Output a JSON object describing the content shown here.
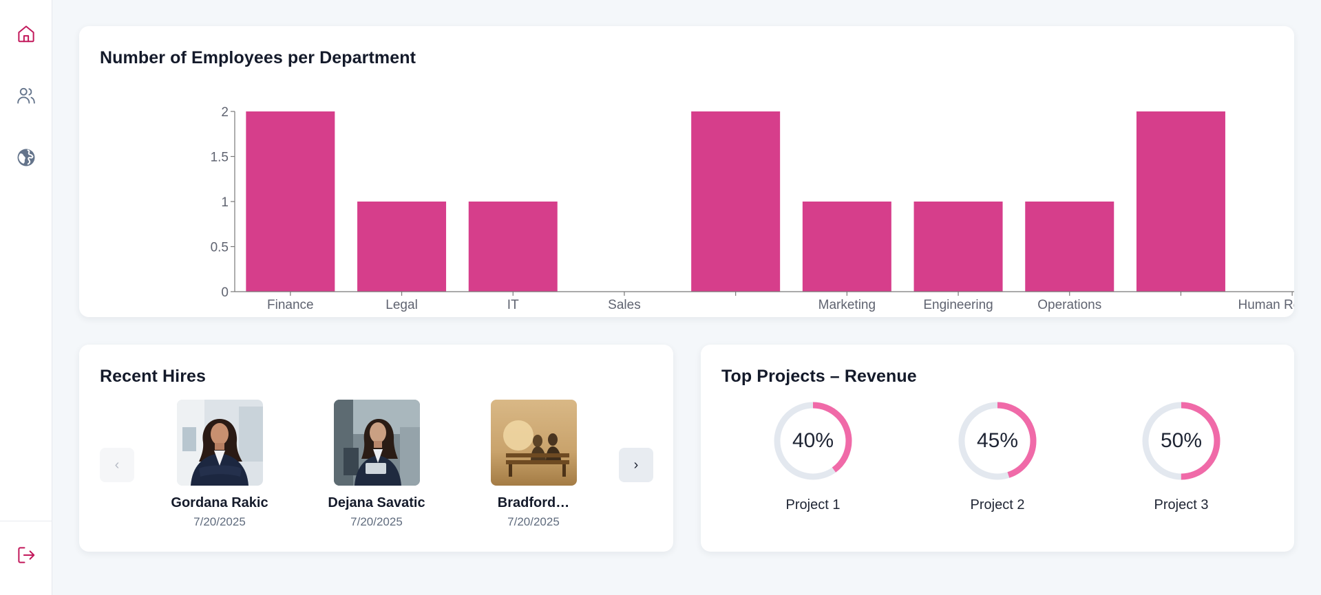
{
  "theme": {
    "accent": "#d63e8b",
    "ring_fill": "#f06aa8",
    "ring_track": "#e3e8ef",
    "nav_active": "#c2185b",
    "nav_muted": "#64748b"
  },
  "nav": {
    "items": [
      {
        "icon": "home-icon",
        "active": true
      },
      {
        "icon": "users-icon",
        "active": false
      },
      {
        "icon": "globe-icon",
        "active": false
      }
    ],
    "logout_icon": "logout-icon"
  },
  "employees_chart": {
    "title": "Number of Employees per Department",
    "chart_data": {
      "type": "bar",
      "categories": [
        "Finance",
        "Legal",
        "IT",
        "Sales",
        "",
        "Marketing",
        "Engineering",
        "Operations",
        "",
        "Human Resources"
      ],
      "values": [
        2,
        1,
        1,
        0,
        2,
        1,
        1,
        1,
        2,
        0
      ],
      "ylim": [
        0,
        2
      ],
      "yticks": [
        "0",
        "0.5",
        "1",
        "1.5",
        "2"
      ],
      "grid": false,
      "bar_color": "#d63e8b"
    }
  },
  "recent_hires": {
    "title": "Recent Hires",
    "prev_label": "‹",
    "next_label": "›",
    "items": [
      {
        "name": "Gordana Rakic",
        "date": "7/20/2025"
      },
      {
        "name": "Dejana Savatic",
        "date": "7/20/2025"
      },
      {
        "name": "Bradford…",
        "date": "7/20/2025"
      }
    ]
  },
  "top_projects": {
    "title": "Top Projects – Revenue",
    "items": [
      {
        "name": "Project 1",
        "percent_label": "40%",
        "percent": 40
      },
      {
        "name": "Project 2",
        "percent_label": "45%",
        "percent": 45
      },
      {
        "name": "Project 3",
        "percent_label": "50%",
        "percent": 50
      }
    ]
  }
}
